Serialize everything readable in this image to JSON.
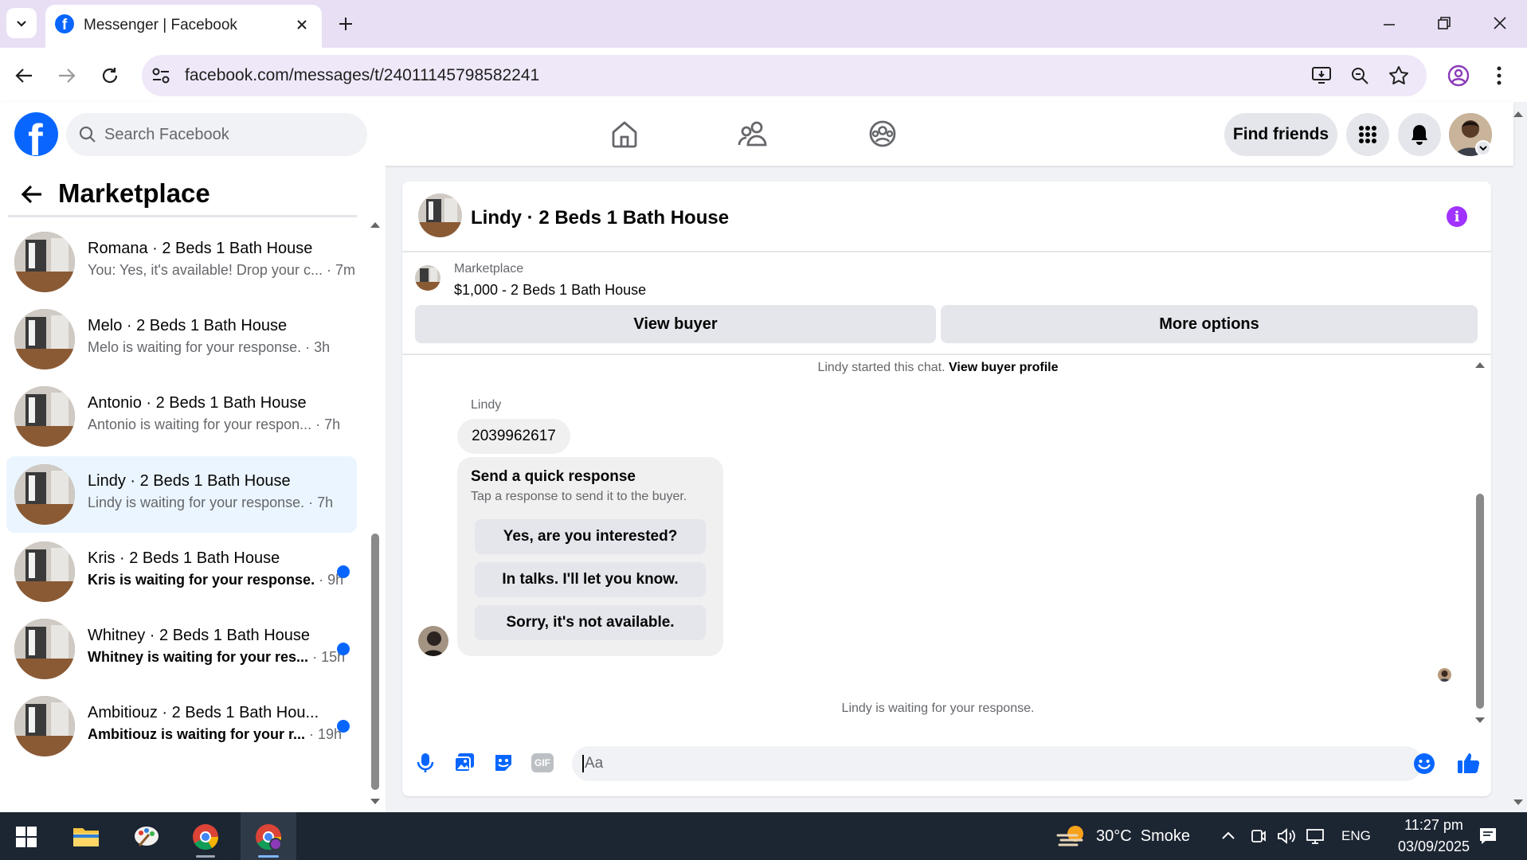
{
  "browser": {
    "tab_title": "Messenger | Facebook",
    "url": "facebook.com/messages/t/24011145798582241"
  },
  "header": {
    "search_placeholder": "Search Facebook",
    "find_friends": "Find friends"
  },
  "sidebar": {
    "title": "Marketplace",
    "conversations": [
      {
        "title": "Romana · 2 Beds 1 Bath House",
        "preview": "You: Yes, it's available! Drop your c...",
        "time": "7m",
        "unread": false,
        "selected": false
      },
      {
        "title": "Melo · 2 Beds 1 Bath House",
        "preview": "Melo is waiting for your response.",
        "time": "3h",
        "unread": false,
        "selected": false
      },
      {
        "title": "Antonio · 2 Beds 1 Bath House",
        "preview": "Antonio is waiting for your respon...",
        "time": "7h",
        "unread": false,
        "selected": false
      },
      {
        "title": "Lindy · 2 Beds 1 Bath House",
        "preview": "Lindy is waiting for your response.",
        "time": "7h",
        "unread": false,
        "selected": true
      },
      {
        "title": "Kris · 2 Beds 1 Bath House",
        "preview": "Kris is waiting for your response.",
        "time": "9h",
        "unread": true,
        "selected": false
      },
      {
        "title": "Whitney · 2 Beds 1 Bath House",
        "preview": "Whitney is waiting for your res...",
        "time": "15h",
        "unread": true,
        "selected": false
      },
      {
        "title": "Ambitiouz · 2 Beds 1 Bath Hou...",
        "preview": "Ambitiouz is waiting for your r...",
        "time": "19h",
        "unread": true,
        "selected": false
      }
    ]
  },
  "chat": {
    "title": "Lindy · 2 Beds 1 Bath House",
    "listing_label": "Marketplace",
    "listing_price": "$1,000 - 2 Beds 1 Bath House",
    "view_buyer": "View buyer",
    "more_options": "More options",
    "started_text": "Lindy started this chat.",
    "view_profile": "View buyer profile",
    "sender_name": "Lindy",
    "message": "2039962617",
    "quick_title": "Send a quick response",
    "quick_sub": "Tap a response to send it to the buyer.",
    "quick_responses": [
      "Yes, are you interested?",
      "In talks. I'll let you know.",
      "Sorry, it's not available."
    ],
    "waiting_text": "Lindy is waiting for your response.",
    "composer_placeholder": "Aa",
    "gif_label": "GIF"
  },
  "taskbar": {
    "weather": "30°C  Smoke",
    "language": "ENG",
    "time": "11:27 pm",
    "date": "03/09/2025"
  },
  "colors": {
    "facebook_blue": "#0866ff",
    "messenger_purple": "#a033ff",
    "selected_row": "#ebf5ff"
  }
}
